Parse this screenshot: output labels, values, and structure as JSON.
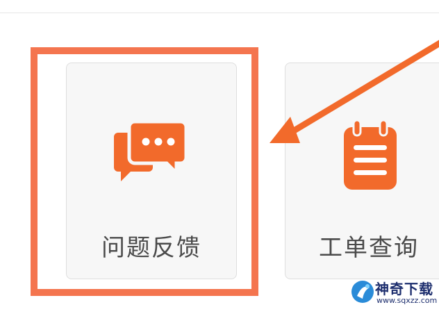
{
  "colors": {
    "accent": "#f4754f",
    "icon_orange": "#f26a2b",
    "card_bg": "#f7f7f7",
    "label": "#4a4a4a",
    "watermark": "#1d2e6e"
  },
  "cards": [
    {
      "label": "问题反馈",
      "icon": "chat-bubbles-icon"
    },
    {
      "label": "工单查询",
      "icon": "notepad-icon"
    }
  ],
  "annotation": {
    "highlight": "highlight-box",
    "arrow": "arrow-icon"
  },
  "watermark": {
    "title": "神奇下载",
    "url": "www.sqxzz.com"
  }
}
